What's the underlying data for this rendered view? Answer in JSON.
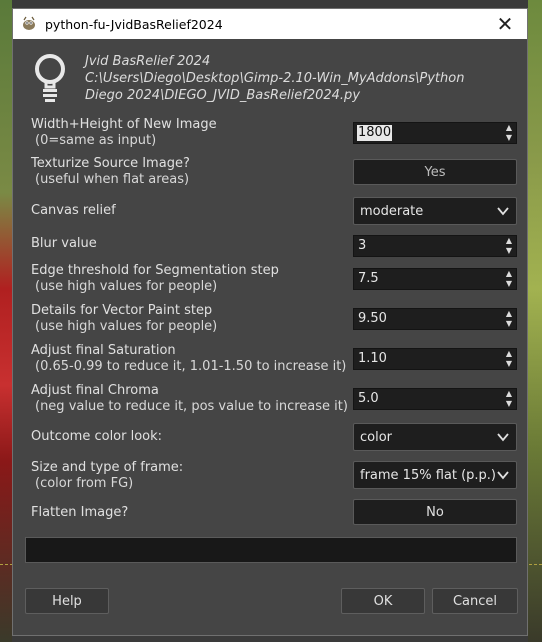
{
  "window": {
    "title": "python-fu-JvidBasRelief2024",
    "close_glyph": "✕"
  },
  "header": {
    "line1": "Jvid BasRelief 2024",
    "line2": "C:\\Users\\Diego\\Desktop\\Gimp-2.10-Win_MyAddons\\Python",
    "line3": "Diego 2024\\DIEGO_JVID_BasRelief2024.py",
    "icon": "lightbulb-icon"
  },
  "fields": {
    "width_height": {
      "label": "Width+Height of New Image",
      "sub": "(0=same as input)",
      "value": "1800"
    },
    "texturize": {
      "label": "Texturize Source Image?",
      "sub": "(useful when flat areas)",
      "value": "Yes"
    },
    "canvas_relief": {
      "label": "Canvas relief",
      "value": "moderate"
    },
    "blur": {
      "label": "Blur value",
      "value": "3"
    },
    "edge_threshold": {
      "label": "Edge threshold for Segmentation step",
      "sub": "(use high values for people)",
      "value": "7.5"
    },
    "details_vector": {
      "label": "Details for Vector Paint step",
      "sub": "(use high values for people)",
      "value": "9.50"
    },
    "saturation": {
      "label": "Adjust final Saturation",
      "sub": "(0.65-0.99 to reduce it, 1.01-1.50 to increase it)",
      "value": "1.10"
    },
    "chroma": {
      "label": "Adjust final Chroma",
      "sub": "(neg value to reduce it, pos value to increase it)",
      "value": "5.0"
    },
    "outcome_color": {
      "label": "Outcome color look:",
      "value": "color"
    },
    "frame": {
      "label": "Size and type of frame:",
      "sub": "(color from FG)",
      "value": "frame 15% flat (p.p.)"
    },
    "flatten": {
      "label": "Flatten Image?",
      "value": "No"
    }
  },
  "buttons": {
    "help": "Help",
    "ok": "OK",
    "cancel": "Cancel"
  },
  "colors": {
    "dialog_bg": "#454545",
    "field_bg": "#1e1e1e",
    "text": "#e0e0e0"
  }
}
